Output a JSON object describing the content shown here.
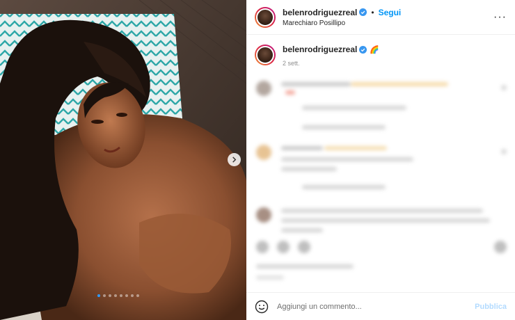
{
  "post": {
    "username": "belenrodriguezreal",
    "follow_label": "Segui",
    "separator": "•",
    "location": "Marechiaro Posillipo",
    "more_label": "···"
  },
  "caption": {
    "username": "belenrodriguezreal",
    "emoji": "🌈",
    "time": "2 sett."
  },
  "media": {
    "slide_count": 8,
    "active_slide": 1
  },
  "comment_box": {
    "placeholder": "Aggiungi un commento...",
    "publish_label": "Pubblica"
  },
  "colors": {
    "accent": "#0095f6",
    "publish_disabled": "#b3dbff",
    "active_dot": "#2f9bff"
  }
}
